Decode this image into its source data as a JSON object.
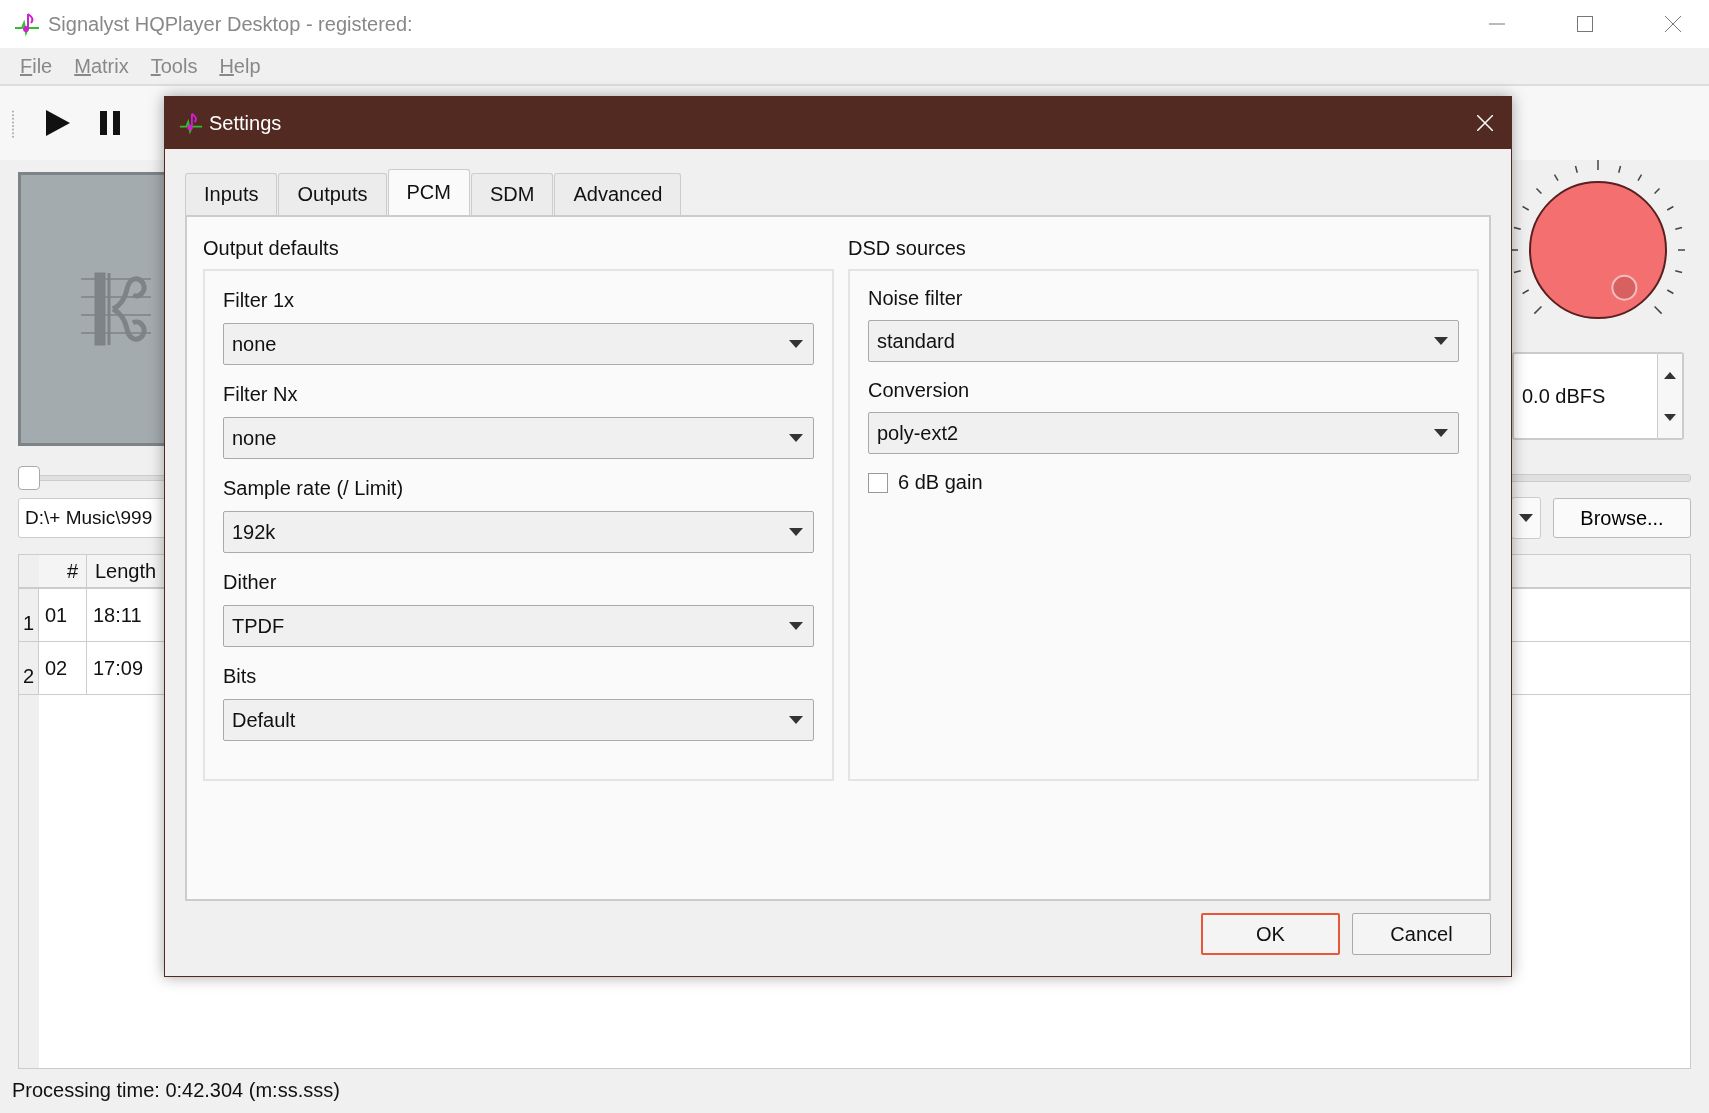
{
  "window": {
    "title": "Signalyst HQPlayer Desktop - registered:"
  },
  "menu": [
    "File",
    "Matrix",
    "Tools",
    "Help"
  ],
  "seek": {
    "level": 0
  },
  "volume": {
    "reading": "0.0 dBFS"
  },
  "path_field": {
    "value": "D:\\+ Music\\999"
  },
  "browse_button": "Browse...",
  "playlist": {
    "columns": [
      "#",
      "Length"
    ],
    "rows": [
      {
        "row_header": "1",
        "cells": [
          "01",
          "18:11"
        ]
      },
      {
        "row_header": "2",
        "cells": [
          "02",
          "17:09"
        ]
      }
    ]
  },
  "status_bar": "Processing time: 0:42.304 (m:ss.sss)",
  "dialog": {
    "title": "Settings",
    "tabs": [
      {
        "label": "Inputs",
        "selected": false
      },
      {
        "label": "Outputs",
        "selected": false
      },
      {
        "label": "PCM",
        "selected": true
      },
      {
        "label": "SDM",
        "selected": false
      },
      {
        "label": "Advanced",
        "selected": false
      }
    ],
    "output_defaults": {
      "title": "Output defaults",
      "fields": [
        {
          "label": "Filter 1x",
          "value": "none"
        },
        {
          "label": "Filter Nx",
          "value": "none"
        },
        {
          "label": "Sample rate (/ Limit)",
          "value": "192k"
        },
        {
          "label": "Dither",
          "value": "TPDF"
        },
        {
          "label": "Bits",
          "value": "Default"
        }
      ]
    },
    "dsd_sources": {
      "title": "DSD sources",
      "fields": [
        {
          "label": "Noise filter",
          "value": "standard"
        },
        {
          "label": "Conversion",
          "value": "poly-ext2"
        }
      ],
      "checkbox": {
        "label": "6 dB gain",
        "checked": false
      }
    },
    "buttons": [
      {
        "label": "OK",
        "focused": true
      },
      {
        "label": "Cancel",
        "focused": false
      }
    ]
  }
}
